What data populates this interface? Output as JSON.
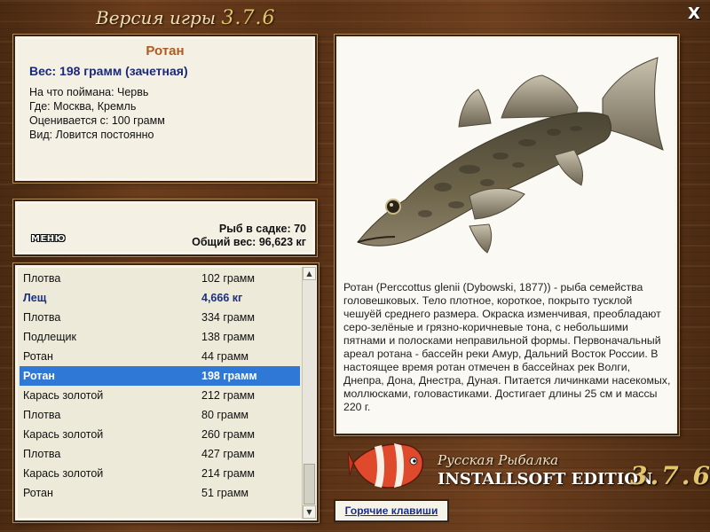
{
  "header": {
    "title_prefix": "Версия игры",
    "title_version": "3.7.6",
    "close_label": "X"
  },
  "fish_info": {
    "name": "Ротан",
    "weight": "Вес: 198 грамм (зачетная)",
    "bait": "На что поймана: Червь",
    "location": "Где: Москва, Кремль",
    "rated_from": "Оценивается с: 100 грамм",
    "kind": "Вид: Ловится постоянно"
  },
  "stats": {
    "menu_label": "МЕНЮ",
    "fish_in_keepnet": "Рыб в садке: 70",
    "total_weight": "Общий вес: 96,623 кг"
  },
  "catch_list": [
    {
      "name": "Плотва",
      "weight": "102 грамм",
      "style": ""
    },
    {
      "name": "Лещ",
      "weight": "4,666 кг",
      "style": "bold"
    },
    {
      "name": "Плотва",
      "weight": "334 грамм",
      "style": ""
    },
    {
      "name": "Подлещик",
      "weight": "138 грамм",
      "style": ""
    },
    {
      "name": "Ротан",
      "weight": "44 грамм",
      "style": ""
    },
    {
      "name": "Ротан",
      "weight": "198 грамм",
      "style": "selected"
    },
    {
      "name": "Карась золотой",
      "weight": "212 грамм",
      "style": ""
    },
    {
      "name": "Плотва",
      "weight": "80 грамм",
      "style": ""
    },
    {
      "name": "Карась золотой",
      "weight": "260 грамм",
      "style": ""
    },
    {
      "name": "Плотва",
      "weight": "427 грамм",
      "style": ""
    },
    {
      "name": "Карась золотой",
      "weight": "214 грамм",
      "style": ""
    },
    {
      "name": "Ротан",
      "weight": "51 грамм",
      "style": ""
    }
  ],
  "description": "Ротан (Perccottus glenii (Dybowski, 1877)) - рыба семейства головешковых. Тело плотное, короткое, покрыто тусклой чешуёй среднего размера. Окраска изменчивая, преобладают серо-зелёные и грязно-коричневые тона, с небольшими пятнами и полосками неправильной формы. Первоначальный ареал ротана - бассейн реки Амур, Дальний Восток России. В настоящее время ротан отмечен в бассейнах рек Волги, Днепра, Дона, Днестра, Дуная. Питается личинками насекомых, моллюсками, головастиками. Достигает длины 25 см и массы 220 г.",
  "logo": {
    "line1": "Русская Рыбалка",
    "line2": "INSTALLSOFT EDITION",
    "version": "3.7.6"
  },
  "hotkeys_label": "Горячие клавиши",
  "colors": {
    "selection": "#2f78d6",
    "fish_name": "#b25a1d",
    "weight_text": "#1a2a7a"
  }
}
